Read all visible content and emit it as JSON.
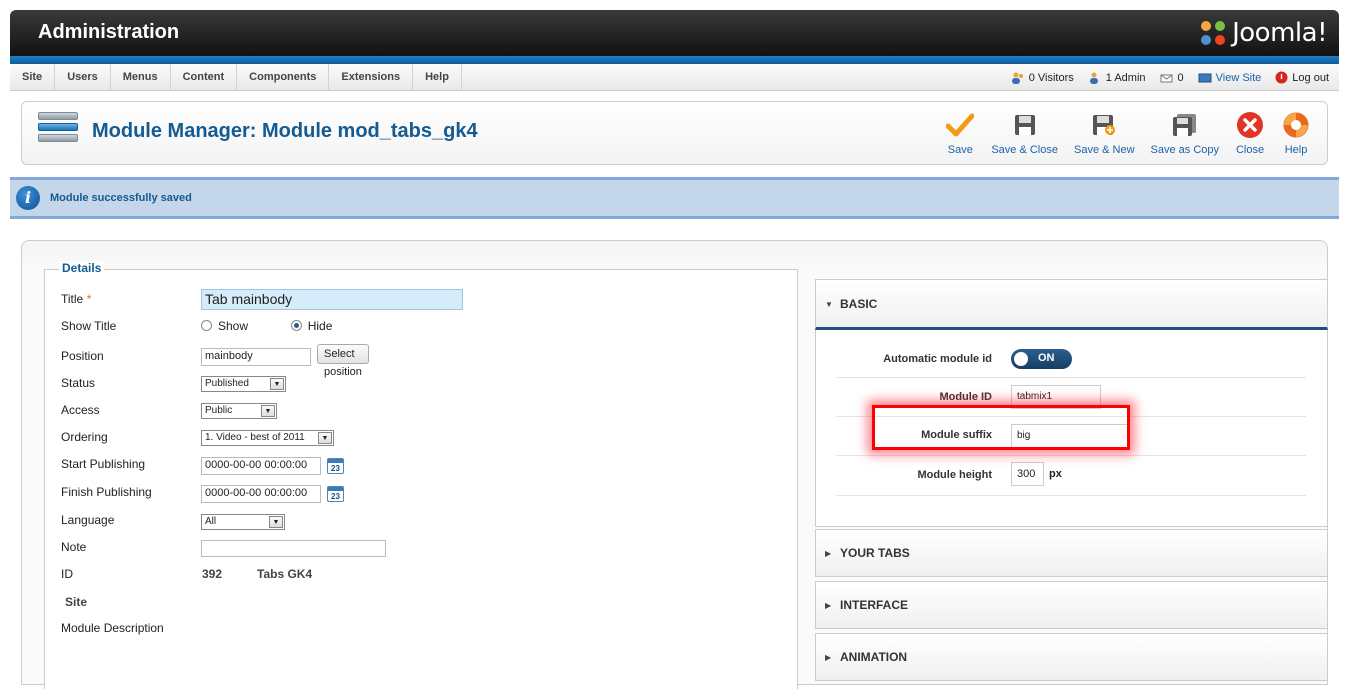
{
  "header": {
    "title": "Administration",
    "logo_text": "Joomla!"
  },
  "menu": {
    "items": [
      "Site",
      "Users",
      "Menus",
      "Content",
      "Components",
      "Extensions",
      "Help"
    ]
  },
  "status": {
    "visitors": "0 Visitors",
    "admins": "1 Admin",
    "messages": "0",
    "view_site": "View Site",
    "logout": "Log out"
  },
  "toolbar": {
    "page_title": "Module Manager: Module mod_tabs_gk4",
    "save": "Save",
    "save_close": "Save & Close",
    "save_new": "Save & New",
    "save_copy": "Save as Copy",
    "close": "Close",
    "help": "Help"
  },
  "message": {
    "text": "Module successfully saved"
  },
  "details": {
    "legend": "Details",
    "title_label": "Title",
    "required_mark": "*",
    "title_value": "Tab mainbody",
    "show_title_label": "Show Title",
    "show_option": "Show",
    "hide_option": "Hide",
    "position_label": "Position",
    "position_value": "mainbody",
    "select_position": "Select position",
    "status_label": "Status",
    "status_value": "Published",
    "access_label": "Access",
    "access_value": "Public",
    "ordering_label": "Ordering",
    "ordering_value": "1. Video - best of 2011",
    "start_label": "Start Publishing",
    "start_value": "0000-00-00 00:00:00",
    "finish_label": "Finish Publishing",
    "finish_value": "0000-00-00 00:00:00",
    "language_label": "Language",
    "language_value": "All",
    "note_label": "Note",
    "note_value": "",
    "id_label": "ID",
    "id_value": "392",
    "module_type": "Tabs GK4",
    "site_label": "Site",
    "description_label": "Module Description",
    "calendar_day": "23"
  },
  "basic": {
    "title": "BASIC",
    "auto_id_label": "Automatic module id",
    "auto_id_value": "ON",
    "module_id_label": "Module ID",
    "module_id_value": "tabmix1",
    "suffix_label": "Module suffix",
    "suffix_value": "big",
    "height_label": "Module height",
    "height_value": "300",
    "height_unit": "px"
  },
  "panels": {
    "your_tabs": "YOUR TABS",
    "interface": "INTERFACE",
    "animation": "ANIMATION"
  },
  "colors": {
    "brand_blue": "#135b92",
    "link_blue": "#1a64a7",
    "highlight_red": "#ff0000"
  }
}
